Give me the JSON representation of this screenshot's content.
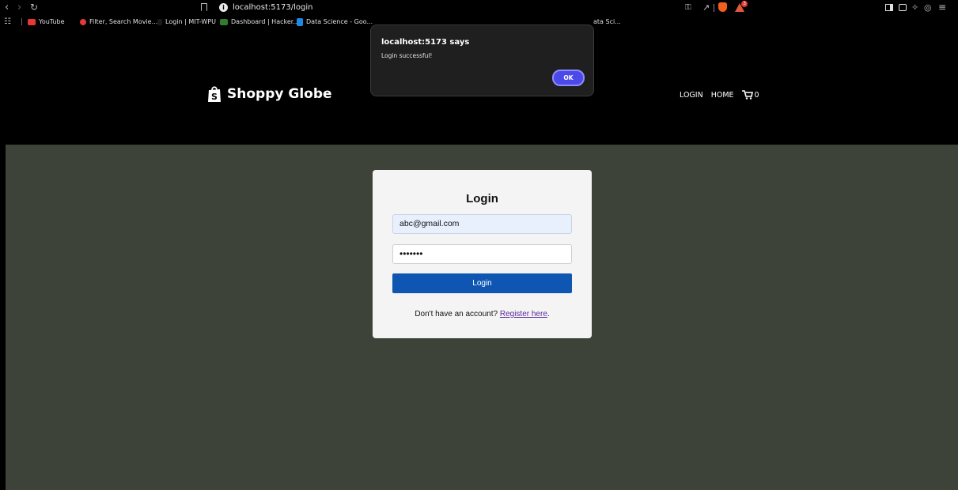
{
  "browser": {
    "url": "localhost:5173/login",
    "bookmarks": [
      {
        "label": "YouTube",
        "color": "#e53935"
      },
      {
        "label": "Filter, Search Movie...",
        "color": "#e53935"
      },
      {
        "label": "Login | MIT-WPU",
        "color": "#1a1a1a"
      },
      {
        "label": "Dashboard | Hacker...",
        "color": "#2e7d32"
      },
      {
        "label": "Data Science - Goo...",
        "color": "#1e88e5"
      }
    ],
    "bookmark_overflow": "ata Sci...",
    "shield_badge": "3"
  },
  "header": {
    "brand": "Shoppy Globe",
    "nav": {
      "login": "LOGIN",
      "home": "HOME",
      "cart_count": "0"
    }
  },
  "login": {
    "title": "Login",
    "email_value": "abc@gmail.com",
    "password_value": "•••••••",
    "button": "Login",
    "register_prefix": "Don't have an account?",
    "register_link": "Register here",
    "register_suffix": "."
  },
  "dialog": {
    "title": "localhost:5173 says",
    "message": "Login successful!",
    "ok": "OK"
  },
  "colors": {
    "page_background": "#3d4338",
    "header_background": "#000000",
    "primary_button": "#0f56b3",
    "dialog_ok": "#4b49e8"
  }
}
